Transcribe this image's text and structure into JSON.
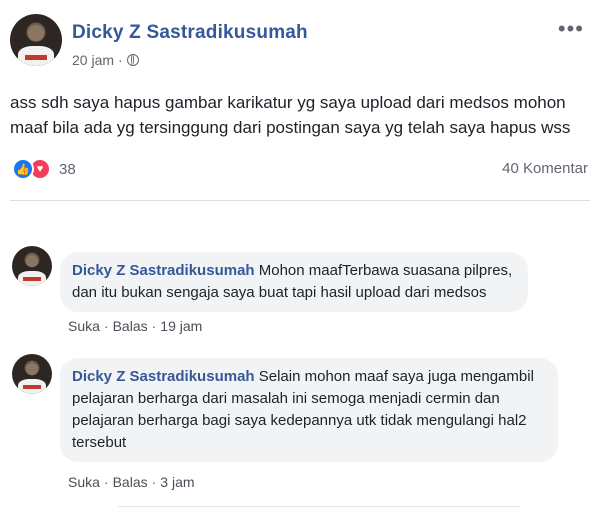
{
  "post": {
    "author": "Dicky Z Sastradikusumah",
    "time": "20 jam",
    "separator": "·",
    "more_icon": "more-options-icon",
    "privacy_icon": "globe-icon",
    "text": "ass sdh saya hapus gambar karikatur yg saya upload dari medsos mohon maaf bila ada yg tersinggung dari postingan saya yg telah saya hapus wss",
    "reaction_count": "38",
    "reaction_icons": [
      "like-icon",
      "love-icon"
    ],
    "comment_count": "40 Komentar"
  },
  "comments": [
    {
      "author": "Dicky Z Sastradikusumah",
      "text": "Mohon maafTerbawa suasana pilpres, dan itu bukan sengaja saya buat tapi hasil upload dari medsos",
      "like": "Suka",
      "reply": "Balas",
      "separator": "·",
      "time": "19 jam"
    },
    {
      "author": "Dicky Z Sastradikusumah",
      "text": "Selain mohon maaf saya juga mengambil pelajaran berharga dari masalah ini semoga menjadi cermin dan pelajaran berharga bagi saya kedepannya utk tidak mengulangi hal2 tersebut",
      "like": "Suka",
      "reply": "Balas",
      "separator": "·",
      "time": "3 jam"
    }
  ],
  "colors": {
    "name_link": "#365899",
    "meta_text": "#606770",
    "bubble_bg": "#f2f3f5",
    "like_blue": "#1877f2",
    "love_red": "#f33e58"
  }
}
